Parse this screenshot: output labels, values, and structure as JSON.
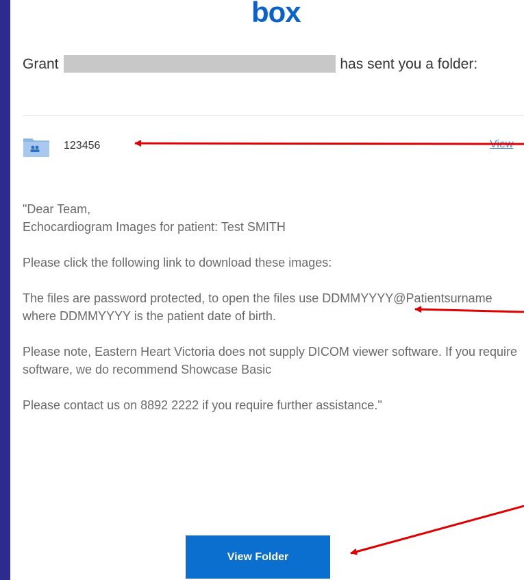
{
  "logo": {
    "text": "box",
    "color": "#0b63c9"
  },
  "email": {
    "sender_prefix": "Grant",
    "sender_suffix": "has sent you a folder:"
  },
  "folder": {
    "icon": "folder-shared-icon",
    "name": "123456",
    "view_label": "View"
  },
  "message": {
    "greeting": "\"Dear Team,",
    "subject_line": "Echocardiogram Images for patient: Test SMITH",
    "download_line": "Please click the following link to download these images:",
    "password_line": "The files are password protected, to open the files use DDMMYYYY@Patientsurname where DDMMYYYY is the patient date of birth.",
    "viewer_line": "Please note, Eastern Heart Victoria does not supply DICOM viewer software. If you require software, we do recommend Showcase Basic",
    "contact_line": "Please contact us on 8892 2222 if you require further assistance.\""
  },
  "button": {
    "label": "View Folder",
    "color": "#0b6fd0"
  },
  "annotation_color": "#e00000"
}
